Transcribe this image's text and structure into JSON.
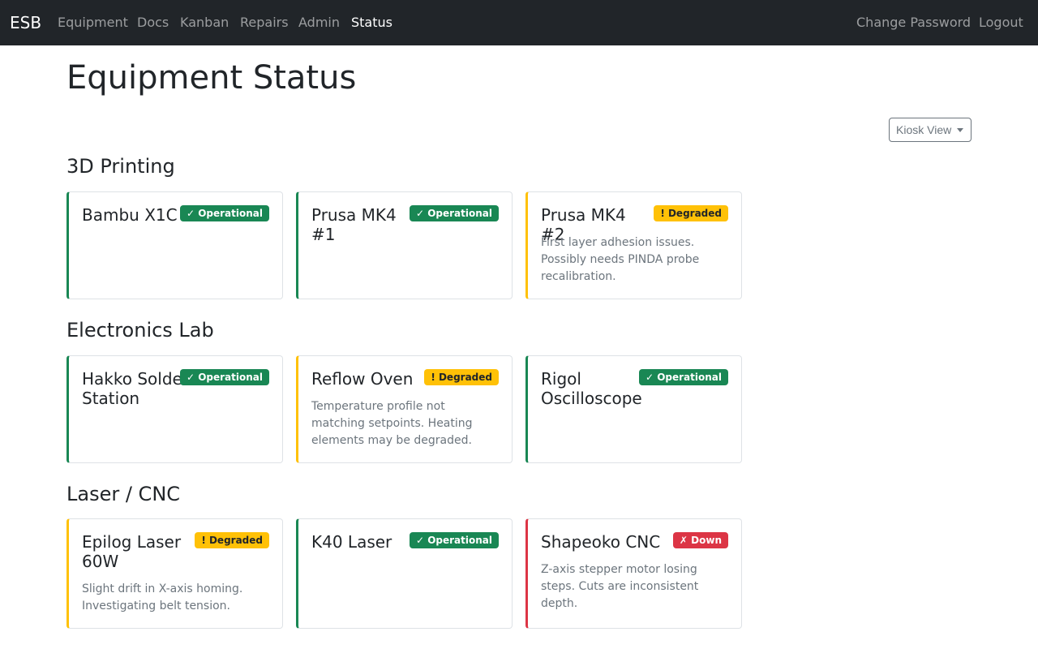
{
  "nav": {
    "brand": "ESB",
    "links": [
      "Equipment",
      "Docs",
      "Kanban",
      "Repairs",
      "Admin",
      "Status"
    ],
    "right_links": [
      "Change Password",
      "Logout"
    ]
  },
  "page": {
    "title": "Equipment Status",
    "view_button": "Kiosk View"
  },
  "sections": [
    {
      "title": "3D Printing",
      "cards": [
        {
          "name": "Bambu X1C",
          "status": "✓ Operational",
          "note": ""
        },
        {
          "name": "Prusa MK4 #1",
          "status": "✓ Operational",
          "note": ""
        },
        {
          "name": "Prusa MK4 #2",
          "status": "! Degraded",
          "note": "First layer adhesion issues. Possibly needs PINDA probe recalibration."
        }
      ]
    },
    {
      "title": "Electronics Lab",
      "cards": [
        {
          "name": "Hakko Solder Station",
          "status": "✓ Operational",
          "note": ""
        },
        {
          "name": "Reflow Oven",
          "status": "! Degraded",
          "note": "Temperature profile not matching setpoints. Heating elements may be degraded."
        },
        {
          "name": "Rigol Oscilloscope",
          "status": "✓ Operational",
          "note": ""
        }
      ]
    },
    {
      "title": "Laser / CNC",
      "cards": [
        {
          "name": "Epilog Laser 60W",
          "status": "! Degraded",
          "note": "Slight drift in X-axis homing. Investigating belt tension."
        },
        {
          "name": "K40 Laser",
          "status": "✓ Operational",
          "note": ""
        },
        {
          "name": "Shapeoko CNC",
          "status": "✗ Down",
          "note": "Z-axis stepper motor losing steps. Cuts are inconsistent depth."
        }
      ]
    }
  ],
  "colors": {
    "operational": "#198754",
    "degraded": "#ffc107",
    "down": "#dc3545",
    "navbar": "#212529"
  }
}
